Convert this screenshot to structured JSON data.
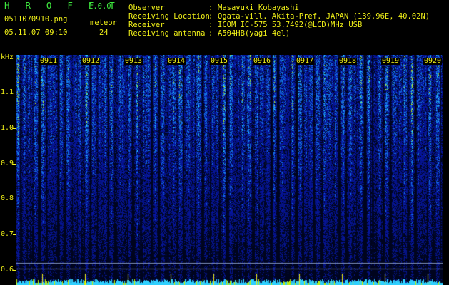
{
  "header": {
    "brand": "H R O F F T",
    "version": "1.0.0",
    "filename": "0511070910.png",
    "meteor_label": "meteor",
    "datetime": "05.11.07 09:10",
    "meteor_count": "24"
  },
  "info": [
    {
      "label": "Observer",
      "value": "Masayuki Kobayashi"
    },
    {
      "label": "Receiving Location",
      "value": "Ogata-vill. Akita-Pref. JAPAN (139.96E, 40.02N)"
    },
    {
      "label": "Receiver",
      "value": "ICOM IC-575 53.7492(@LCD)MHz USB"
    },
    {
      "label": "Receiving antenna",
      "value": "A504HB(yagi 4el)"
    }
  ],
  "colon": ":",
  "spectrogram": {
    "y_unit": "kHz",
    "y_ticks": [
      "1.1",
      "1.0",
      "0.9",
      "0.8",
      "0.7",
      "0.6"
    ],
    "time_labels": [
      "0911",
      "0912",
      "0913",
      "0914",
      "0915",
      "0916",
      "0917",
      "0918",
      "0919",
      "0920"
    ],
    "colors": {
      "low": "#000a2a",
      "mid": "#1840e0",
      "high": "#30d0ff",
      "peak": "#c8f000",
      "marker": "#f0f018"
    }
  }
}
